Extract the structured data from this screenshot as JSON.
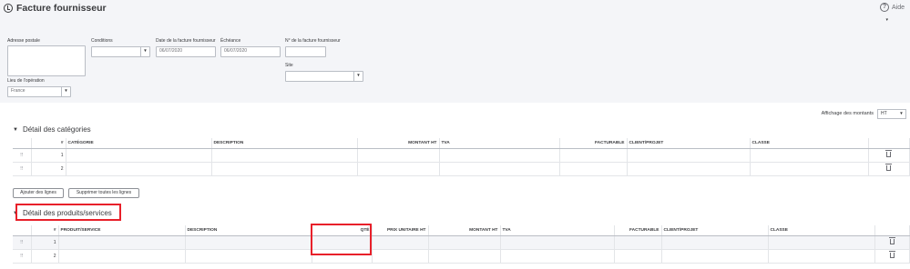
{
  "header": {
    "title": "Facture fournisseur",
    "help_label": "Aide",
    "help_caret": "▾"
  },
  "form": {
    "address_label": "Adresse postale",
    "terms_label": "Conditions",
    "bill_date_label": "Date de la facture fournisseur",
    "bill_date_value": "06/07/2020",
    "due_date_label": "Échéance",
    "due_date_value": "06/07/2020",
    "bill_no_label": "N° de la facture fournisseur",
    "location_label": "Site",
    "place_label": "Lieu de l'opération",
    "place_value": "France"
  },
  "amounts": {
    "label": "Affichage des montants",
    "value": "HT"
  },
  "categories_section": {
    "title": "Détail des catégories",
    "columns": [
      "#",
      "CATÉGORIE",
      "DESCRIPTION",
      "MONTANT HT",
      "TVA",
      "FACTURABLE",
      "CLIENT/PROJET",
      "CLASSE"
    ],
    "rows": [
      {
        "handle": "⠿",
        "num": "1"
      },
      {
        "handle": "⠿",
        "num": "2"
      }
    ],
    "add_lines_label": "Ajouter des lignes",
    "clear_lines_label": "Supprimer toutes les lignes"
  },
  "products_section": {
    "title": "Détail des produits/services",
    "columns": [
      "#",
      "PRODUIT/SERVICE",
      "DESCRIPTION",
      "QTÉ",
      "PRIX UNITAIRE HT",
      "MONTANT HT",
      "TVA",
      "FACTURABLE",
      "CLIENT/PROJET",
      "CLASSE"
    ],
    "rows": [
      {
        "handle": "⠿",
        "num": "1"
      },
      {
        "handle": "⠿",
        "num": "2"
      }
    ]
  },
  "icons": {
    "title_icon": "clock-refresh-icon",
    "help_icon": "question-circle-icon",
    "trash_icon": "trash-icon",
    "handle_icon": "drag-handle-icon",
    "dropdown_icon": "chevron-down-icon",
    "collapse_icon": "triangle-down-icon"
  },
  "colors": {
    "header_band": "#f4f5f8",
    "highlight": "#e8202a",
    "text": "#393a3d"
  }
}
